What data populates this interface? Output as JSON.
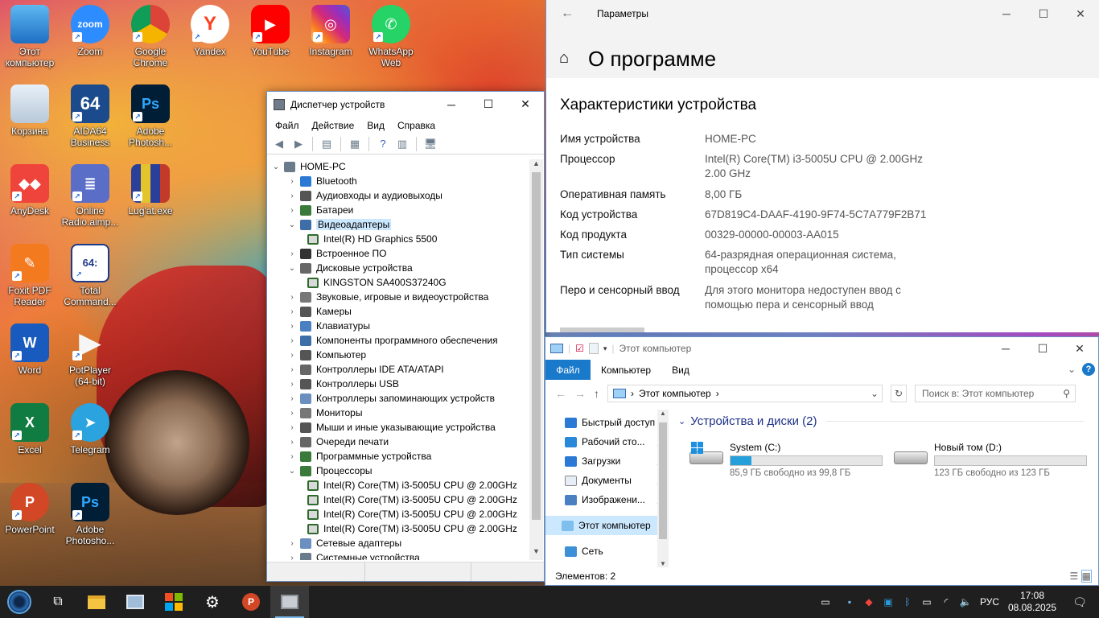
{
  "desktop": {
    "icons": [
      {
        "label": "Этот компьютер",
        "icon": "this-pc-icon"
      },
      {
        "label": "Zoom",
        "icon": "zoom-icon"
      },
      {
        "label": "Google Chrome",
        "icon": "chrome-icon"
      },
      {
        "label": "Yandex",
        "icon": "yandex-icon"
      },
      {
        "label": "YouTube",
        "icon": "youtube-icon"
      },
      {
        "label": "Instagram",
        "icon": "instagram-icon"
      },
      {
        "label": "WhatsApp Web",
        "icon": "whatsapp-icon"
      },
      {
        "label": "Корзина",
        "icon": "recycle-bin-icon"
      },
      {
        "label": "AIDA64 Business",
        "icon": "aida64-icon"
      },
      {
        "label": "Adobe Photosh...",
        "icon": "photoshop-icon"
      },
      {
        "label": "AnyDesk",
        "icon": "anydesk-icon"
      },
      {
        "label": "Online Radio.aimp...",
        "icon": "radio-icon"
      },
      {
        "label": "Lug'at.exe",
        "icon": "books-icon"
      },
      {
        "label": "Foxit PDF Reader",
        "icon": "foxit-icon"
      },
      {
        "label": "Total Command...",
        "icon": "total-commander-icon"
      },
      {
        "label": "Word",
        "icon": "word-icon"
      },
      {
        "label": "PotPlayer (64-bit)",
        "icon": "potplayer-icon"
      },
      {
        "label": "Excel",
        "icon": "excel-icon"
      },
      {
        "label": "Telegram",
        "icon": "telegram-icon"
      },
      {
        "label": "PowerPoint",
        "icon": "powerpoint-icon"
      },
      {
        "label": "Adobe Photosho...",
        "icon": "photoshop-icon"
      }
    ],
    "icon_glyphs": {
      "zoom": "zoom",
      "aida": "64",
      "ps": "Ps",
      "ppt": "P",
      "excel": "X",
      "word": "W",
      "yandex": "Y",
      "total_cmd": "64:"
    }
  },
  "device_manager": {
    "title": "Диспетчер устройств",
    "menu": [
      "Файл",
      "Действие",
      "Вид",
      "Справка"
    ],
    "tree": [
      {
        "label": "HOME-PC",
        "level": 0,
        "expanded": true
      },
      {
        "label": "Bluetooth",
        "level": 1,
        "expanded": false
      },
      {
        "label": "Аудиовходы и аудиовыходы",
        "level": 1,
        "expanded": false
      },
      {
        "label": "Батареи",
        "level": 1,
        "expanded": false
      },
      {
        "label": "Видеоадаптеры",
        "level": 1,
        "expanded": true,
        "selected": true
      },
      {
        "label": "Intel(R) HD Graphics 5500",
        "level": 2
      },
      {
        "label": "Встроенное ПО",
        "level": 1,
        "expanded": false
      },
      {
        "label": "Дисковые устройства",
        "level": 1,
        "expanded": true
      },
      {
        "label": "KINGSTON SA400S37240G",
        "level": 2
      },
      {
        "label": "Звуковые, игровые и видеоустройства",
        "level": 1,
        "expanded": false
      },
      {
        "label": "Камеры",
        "level": 1,
        "expanded": false
      },
      {
        "label": "Клавиатуры",
        "level": 1,
        "expanded": false
      },
      {
        "label": "Компоненты программного обеспечения",
        "level": 1,
        "expanded": false
      },
      {
        "label": "Компьютер",
        "level": 1,
        "expanded": false
      },
      {
        "label": "Контроллеры IDE ATA/ATAPI",
        "level": 1,
        "expanded": false
      },
      {
        "label": "Контроллеры USB",
        "level": 1,
        "expanded": false
      },
      {
        "label": "Контроллеры запоминающих устройств",
        "level": 1,
        "expanded": false
      },
      {
        "label": "Мониторы",
        "level": 1,
        "expanded": false
      },
      {
        "label": "Мыши и иные указывающие устройства",
        "level": 1,
        "expanded": false
      },
      {
        "label": "Очереди печати",
        "level": 1,
        "expanded": false
      },
      {
        "label": "Программные устройства",
        "level": 1,
        "expanded": false
      },
      {
        "label": "Процессоры",
        "level": 1,
        "expanded": true
      },
      {
        "label": "Intel(R) Core(TM) i3-5005U CPU @ 2.00GHz",
        "level": 2
      },
      {
        "label": "Intel(R) Core(TM) i3-5005U CPU @ 2.00GHz",
        "level": 2
      },
      {
        "label": "Intel(R) Core(TM) i3-5005U CPU @ 2.00GHz",
        "level": 2
      },
      {
        "label": "Intel(R) Core(TM) i3-5005U CPU @ 2.00GHz",
        "level": 2
      },
      {
        "label": "Сетевые адаптеры",
        "level": 1,
        "expanded": false
      },
      {
        "label": "Системные устройства",
        "level": 1,
        "expanded": false
      }
    ]
  },
  "settings": {
    "app_title": "Параметры",
    "page_title": "О программе",
    "section_title": "Характеристики устройства",
    "specs": [
      {
        "key": "Имя устройства",
        "value": "HOME-PC"
      },
      {
        "key": "Процессор",
        "value": "Intel(R) Core(TM) i3-5005U CPU @ 2.00GHz 2.00 GHz"
      },
      {
        "key": "Оперативная память",
        "value": "8,00 ГБ"
      },
      {
        "key": "Код устройства",
        "value": "67D819C4-DAAF-4190-9F74-5C7A779F2B71"
      },
      {
        "key": "Код продукта",
        "value": "00329-00000-00003-AA015"
      },
      {
        "key": "Тип системы",
        "value": "64-разрядная операционная система, процессор x64"
      },
      {
        "key": "Перо и сенсорный ввод",
        "value": "Для этого монитора недоступен ввод с помощью пера и сенсорный ввод"
      }
    ]
  },
  "explorer": {
    "title": "Этот компьютер",
    "ribbon": {
      "file": "Файл",
      "tabs": [
        "Компьютер",
        "Вид"
      ],
      "help": "?"
    },
    "address": "Этот компьютер",
    "search_placeholder": "Поиск в: Этот компьютер",
    "nav": [
      {
        "label": "Быстрый доступ",
        "icon": "star-icon",
        "pinned": false
      },
      {
        "label": "Рабочий сто...",
        "icon": "desktop-folder-icon",
        "pinned": true
      },
      {
        "label": "Загрузки",
        "icon": "downloads-icon",
        "pinned": true
      },
      {
        "label": "Документы",
        "icon": "documents-icon",
        "pinned": true
      },
      {
        "label": "Изображени...",
        "icon": "pictures-icon",
        "pinned": true
      },
      {
        "label": "Этот компьютер",
        "icon": "this-pc-icon",
        "pinned": false,
        "selected": true
      },
      {
        "label": "Сеть",
        "icon": "network-icon",
        "pinned": false
      }
    ],
    "group_title": "Устройства и диски (2)",
    "drives": [
      {
        "name": "System (C:)",
        "free": "85,9 ГБ свободно из 99,8 ГБ",
        "used_fraction": 0.14
      },
      {
        "name": "Новый том (D:)",
        "free": "123 ГБ свободно из 123 ГБ",
        "used_fraction": 0.0
      }
    ],
    "status": "Элементов: 2"
  },
  "taskbar": {
    "items": [
      "start-icon",
      "task-view-icon",
      "file-explorer-icon",
      "control-panel-icon",
      "microsoft-store-icon",
      "settings-gear-icon",
      "powerpoint-icon",
      "device-manager-icon"
    ],
    "language": "РУС",
    "time": "17:08",
    "date": "08.08.2025"
  },
  "colors": {
    "accent": "#1979ca",
    "selection": "#cce8ff",
    "drive_bar": "#26a0da",
    "taskbar": "#1f1f1f"
  }
}
